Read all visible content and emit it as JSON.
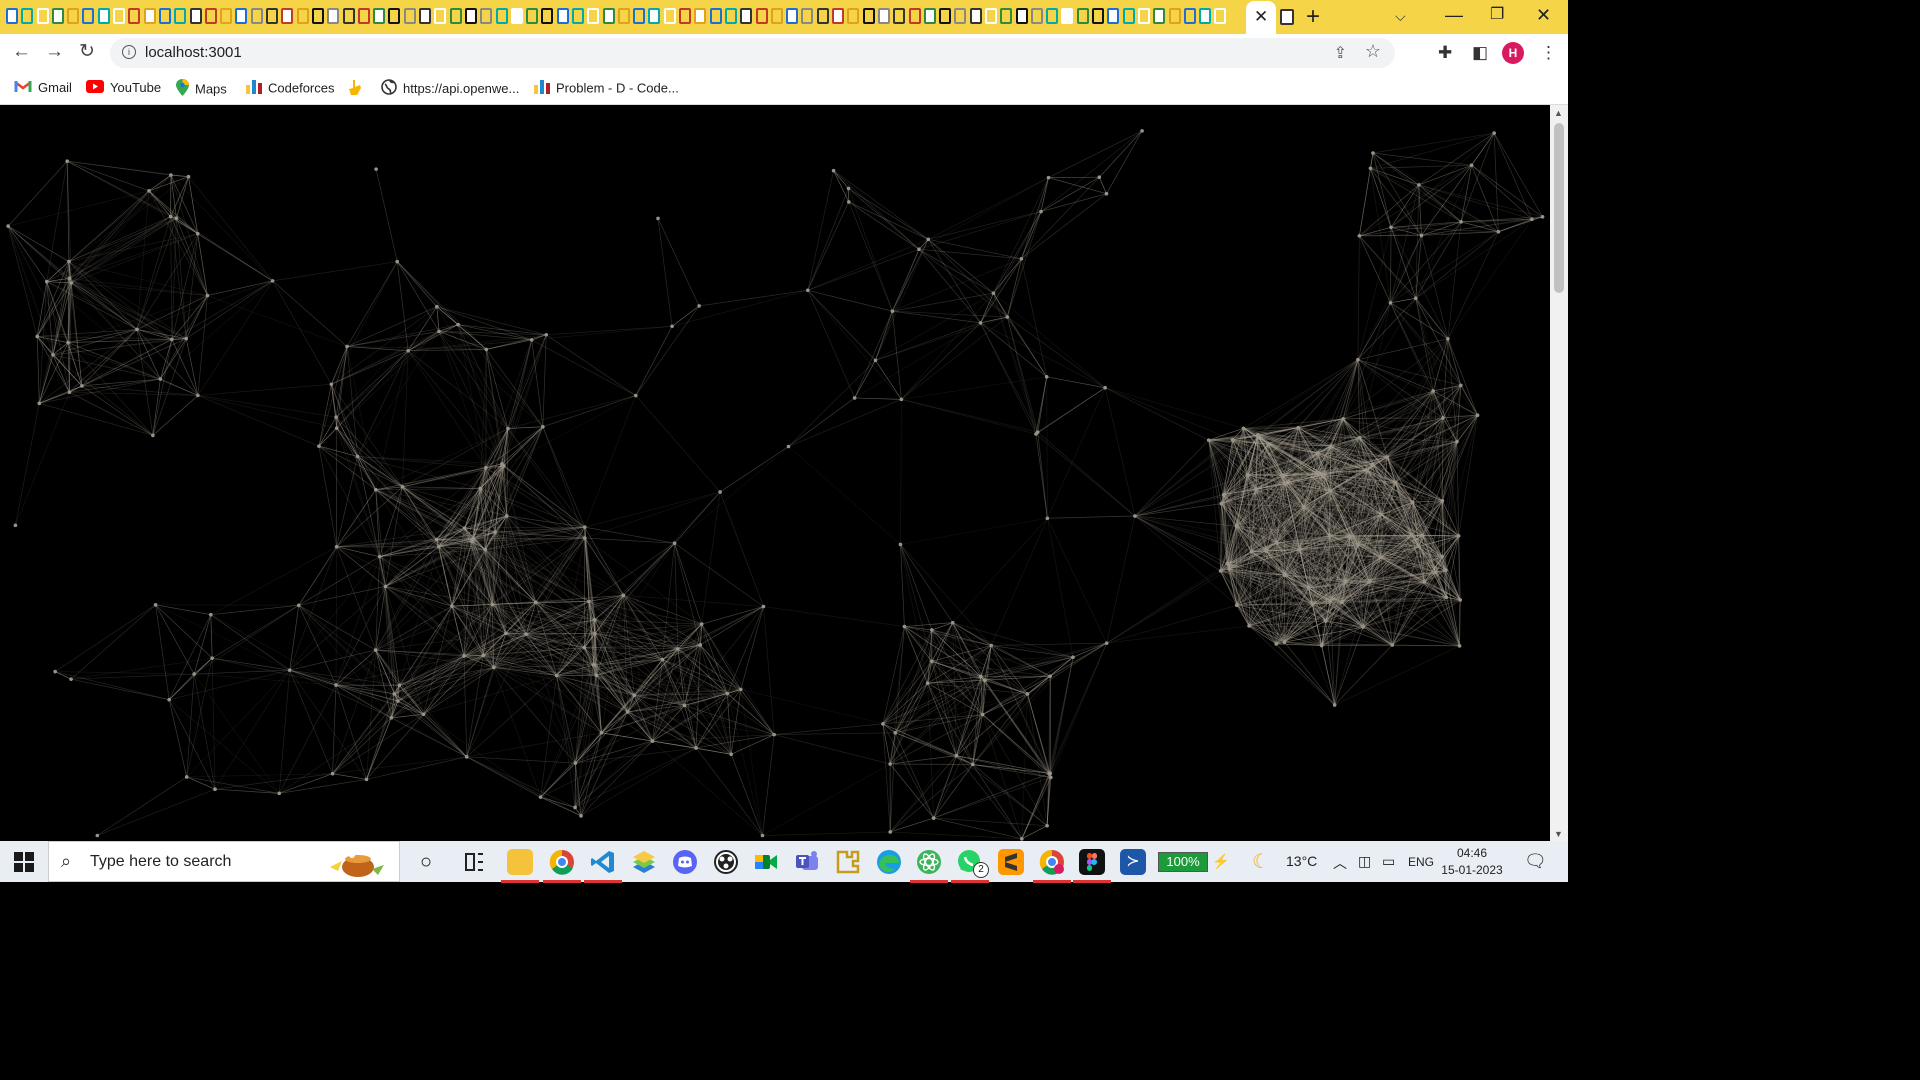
{
  "browser": {
    "url": "localhost:3001",
    "profile_initial": "H",
    "accent_color": "#f5d547"
  },
  "bookmarks": [
    {
      "label": "Gmail",
      "icon": "gmail-icon"
    },
    {
      "label": "YouTube",
      "icon": "youtube-icon"
    },
    {
      "label": "Maps",
      "icon": "maps-icon"
    },
    {
      "label": "Codeforces",
      "icon": "codeforces-icon"
    },
    {
      "label": "",
      "icon": "hand-icon"
    },
    {
      "label": "https://api.openwe...",
      "icon": "globe-icon"
    },
    {
      "label": "Problem - D - Code...",
      "icon": "codeforces-icon"
    }
  ],
  "taskbar": {
    "search_placeholder": "Type here to search",
    "battery_percent": "100%",
    "temperature": "13°C",
    "language": "ENG",
    "time": "04:46",
    "date": "15-01-2023",
    "whatsapp_badge": "2",
    "apps": [
      "cortana-icon",
      "task-view-icon",
      "file-explorer-icon",
      "chrome-icon",
      "vscode-icon",
      "bluestacks-icon",
      "discord-icon",
      "obs-icon",
      "meet-icon",
      "teams-icon",
      "puzzle-icon",
      "edge-icon",
      "atom-icon",
      "whatsapp-icon",
      "sublime-icon",
      "chrome-profile-icon",
      "figma-icon",
      "powershell-icon"
    ]
  },
  "page": {
    "background": "#000000",
    "line_color": "#b8b0a0"
  }
}
